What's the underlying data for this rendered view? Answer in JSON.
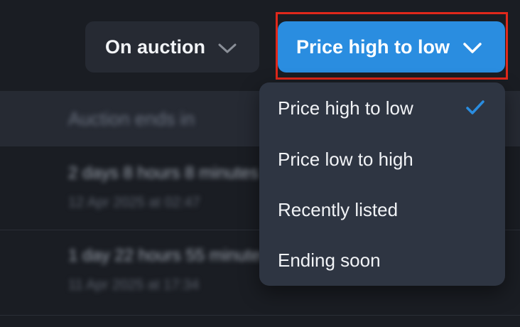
{
  "filter": {
    "label": "On auction",
    "icon": "chevron-down-icon"
  },
  "sort": {
    "label": "Price high to low",
    "icon": "chevron-down-icon",
    "color": "#2a8de0",
    "highlight_color": "#e0281b"
  },
  "sort_menu": {
    "items": [
      {
        "label": "Price high to low",
        "selected": true
      },
      {
        "label": "Price low to high",
        "selected": false
      },
      {
        "label": "Recently listed",
        "selected": false
      },
      {
        "label": "Ending soon",
        "selected": false
      }
    ],
    "check_color": "#2a8de0"
  },
  "background_table": {
    "header": "Auction ends in",
    "rows": [
      {
        "time_left": "2 days 8 hours 8 minutes",
        "end_date": "12 Apr 2025 at 02:47"
      },
      {
        "time_left": "1 day 22 hours 55 minutes",
        "end_date": "11 Apr 2025 at 17:34"
      }
    ]
  }
}
